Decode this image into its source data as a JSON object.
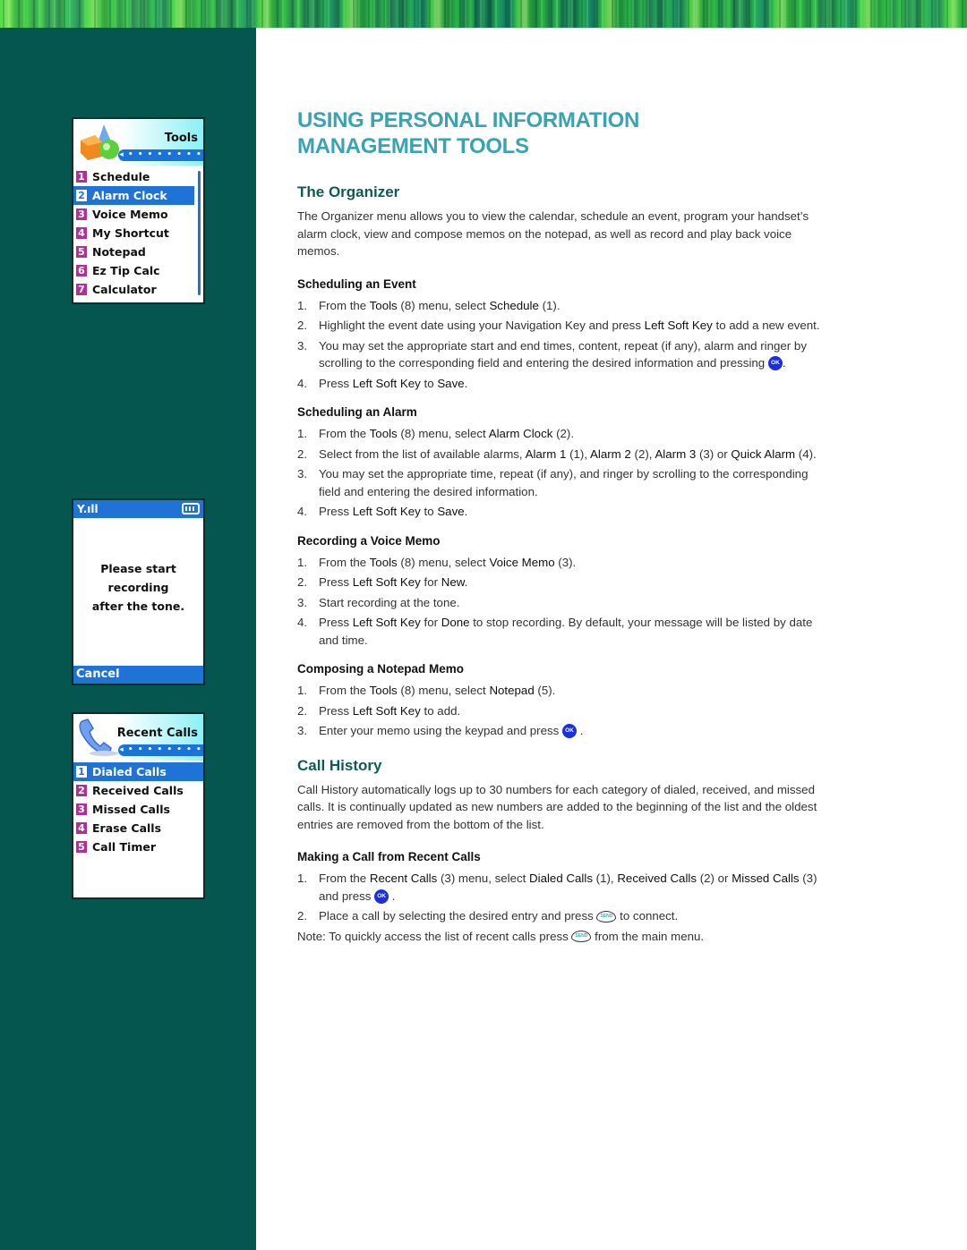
{
  "colors": {
    "sidebar": "#04564f",
    "title": "#3aa3b2",
    "heading": "#0d5b57",
    "phone_highlight": "#1f73d6",
    "phone_number_badge": "#b0309a",
    "ok_button": "#1a2fe0"
  },
  "screens": {
    "tools": {
      "title": "Tools",
      "nav": "◂ • • • • • • • • ▸",
      "icon": "shapes-icon",
      "items": [
        {
          "num": "1",
          "label": "Schedule"
        },
        {
          "num": "2",
          "label": "Alarm Clock",
          "selected": true
        },
        {
          "num": "3",
          "label": "Voice Memo"
        },
        {
          "num": "4",
          "label": "My Shortcut"
        },
        {
          "num": "5",
          "label": "Notepad"
        },
        {
          "num": "6",
          "label": "Ez Tip Calc"
        },
        {
          "num": "7",
          "label": "Calculator"
        }
      ]
    },
    "record": {
      "signal": "Y.ıll",
      "message_lines": [
        "Please  start",
        "recording",
        "after the tone."
      ],
      "soft_key": "Cancel"
    },
    "recent": {
      "title": "Recent Calls",
      "nav": "◂ • • • • • • • • ▸",
      "icon": "phone-handset-icon",
      "items": [
        {
          "num": "1",
          "label": "Dialed Calls",
          "selected": true
        },
        {
          "num": "2",
          "label": "Received Calls"
        },
        {
          "num": "3",
          "label": "Missed Calls"
        },
        {
          "num": "4",
          "label": "Erase Calls"
        },
        {
          "num": "5",
          "label": "Call Timer"
        }
      ]
    }
  },
  "page": {
    "title_line1": "USING PERSONAL INFORMATION",
    "title_line2": "MANAGEMENT TOOLS",
    "organizer": {
      "heading": "The Organizer",
      "intro": "The Organizer menu allows you to view the calendar, schedule an event, program your handset’s alarm clock, view and compose memos on the notepad, as well as record and play back voice memos.",
      "event": {
        "heading": "Scheduling an Event",
        "s1": [
          "From the ",
          "Tools",
          " (8) menu, select ",
          "Schedule",
          " (1)."
        ],
        "s2": [
          "Highlight the event date using your Navigation Key and press ",
          "Left Soft Key",
          " to add a new event."
        ],
        "s3": [
          "You may set the appropriate start and end times, content, repeat (if any), alarm and ringer by scrolling to the corresponding field and entering the desired information and pressing ",
          "."
        ],
        "s4": [
          "Press ",
          "Left Soft Key",
          " to ",
          "Save",
          "."
        ]
      },
      "alarm": {
        "heading": "Scheduling an Alarm",
        "s1": [
          "From the ",
          "Tools",
          " (8) menu, select ",
          "Alarm Clock",
          " (2)."
        ],
        "s2": [
          "Select from the list of available alarms, ",
          "Alarm 1",
          " (1), ",
          "Alarm 2",
          " (2), ",
          "Alarm 3",
          " (3) or ",
          "Quick Alarm",
          " (4)."
        ],
        "s3": "You may set the appropriate time, repeat (if any), and ringer by scrolling to the corresponding field and entering the desired information.",
        "s4": [
          "Press ",
          "Left Soft Key",
          " to ",
          "Save",
          "."
        ]
      },
      "voice": {
        "heading": "Recording a Voice Memo",
        "s1": [
          "From the ",
          "Tools",
          " (8) menu, select ",
          "Voice Memo",
          " (3)."
        ],
        "s2": [
          "Press ",
          "Left Soft Key",
          " for ",
          "New",
          "."
        ],
        "s3": "Start recording at the tone.",
        "s4": [
          "Press ",
          "Left Soft Key",
          " for ",
          "Done",
          " to stop recording. By default, your message will be listed by date and time."
        ]
      },
      "notepad": {
        "heading": "Composing a Notepad Memo",
        "s1": [
          "From the ",
          "Tools",
          " (8) menu, select ",
          "Notepad",
          " (5)."
        ],
        "s2": [
          "Press ",
          "Left Soft Key",
          " to add."
        ],
        "s3": [
          "Enter your memo using the keypad and press ",
          " ."
        ]
      }
    },
    "history": {
      "heading": "Call History",
      "intro": "Call History automatically logs up to 30 numbers for each category of dialed, received, and missed calls. It is continually updated as new numbers are added to the beginning of the list and the oldest entries are removed from the bottom of the list.",
      "making": {
        "heading": "Making a Call from Recent Calls",
        "s1": [
          "From the ",
          "Recent Calls",
          " (3) menu, select ",
          "Dialed Calls",
          " (1), ",
          "Received Calls",
          " (2) or ",
          "Missed Calls",
          " (3) and press ",
          " ."
        ],
        "s2": [
          "Place a call by selecting the desired entry and press ",
          " to connect."
        ]
      },
      "note": [
        "Note: To quickly access the list of recent calls press ",
        " from the main menu."
      ]
    },
    "ok_label": "OK",
    "send_label": "SEND",
    "step_numbers": [
      "1.",
      "2.",
      "3.",
      "4."
    ]
  }
}
